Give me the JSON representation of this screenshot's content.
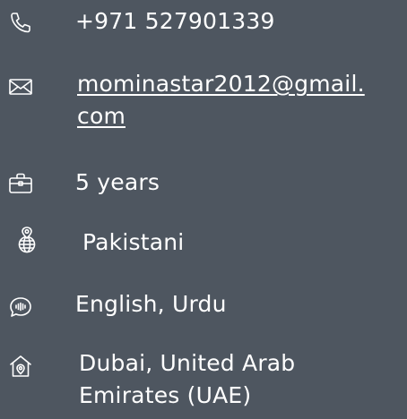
{
  "contact": {
    "phone": {
      "icon": "phone-icon",
      "value": "+971 527901339"
    },
    "email": {
      "icon": "mail-icon",
      "value_line1": "mominastar2012@gmail.",
      "value_line2": "com"
    },
    "experience": {
      "icon": "briefcase-icon",
      "value": "5 years"
    },
    "nationality": {
      "icon": "globe-pin-icon",
      "value": "Pakistani"
    },
    "languages": {
      "icon": "speech-bubble-icon",
      "value": "English, Urdu"
    },
    "location": {
      "icon": "home-pin-icon",
      "value_line1": "Dubai, United Arab",
      "value_line2": "Emirates (UAE)"
    }
  },
  "colors": {
    "background": "#4e5660",
    "text": "#ffffff"
  }
}
